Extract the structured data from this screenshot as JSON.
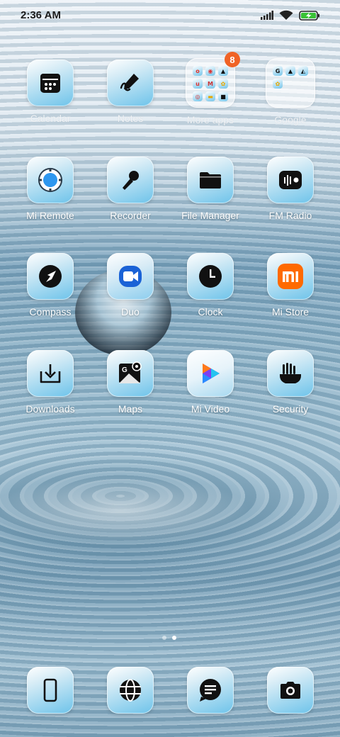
{
  "status_bar": {
    "time": "2:36 AM",
    "icons": [
      "signal-icon",
      "wifi-icon",
      "battery-charging-icon"
    ],
    "battery_color": "#39c236"
  },
  "home": {
    "rows": [
      [
        {
          "label": "Calendar",
          "icon": "calendar-icon"
        },
        {
          "label": "Notes",
          "icon": "notes-icon"
        },
        {
          "label": "More apps",
          "icon": "folder-icon",
          "badge": "8"
        },
        {
          "label": "Google",
          "icon": "folder-icon"
        }
      ],
      [
        {
          "label": "Mi Remote",
          "icon": "mi-remote-icon"
        },
        {
          "label": "Recorder",
          "icon": "microphone-icon"
        },
        {
          "label": "File Manager",
          "icon": "folder-file-icon"
        },
        {
          "label": "FM Radio",
          "icon": "radio-icon"
        }
      ],
      [
        {
          "label": "Compass",
          "icon": "compass-icon"
        },
        {
          "label": "Duo",
          "icon": "duo-video-icon"
        },
        {
          "label": "Clock",
          "icon": "clock-icon"
        },
        {
          "label": "Mi Store",
          "icon": "mi-store-icon"
        }
      ],
      [
        {
          "label": "Downloads",
          "icon": "download-icon"
        },
        {
          "label": "Maps",
          "icon": "maps-icon"
        },
        {
          "label": "Mi Video",
          "icon": "mi-video-icon"
        },
        {
          "label": "Security",
          "icon": "security-icon"
        }
      ]
    ],
    "more_apps_badge": "8",
    "page_indicator": {
      "pages": 2,
      "current": 2
    }
  },
  "dock": [
    {
      "icon": "phone-icon"
    },
    {
      "icon": "browser-globe-icon"
    },
    {
      "icon": "messages-icon"
    },
    {
      "icon": "camera-icon"
    }
  ],
  "colors": {
    "badge": "#f06326",
    "tile_gradient_end": "#6dc3ea",
    "mi_orange": "#ff6a00"
  }
}
